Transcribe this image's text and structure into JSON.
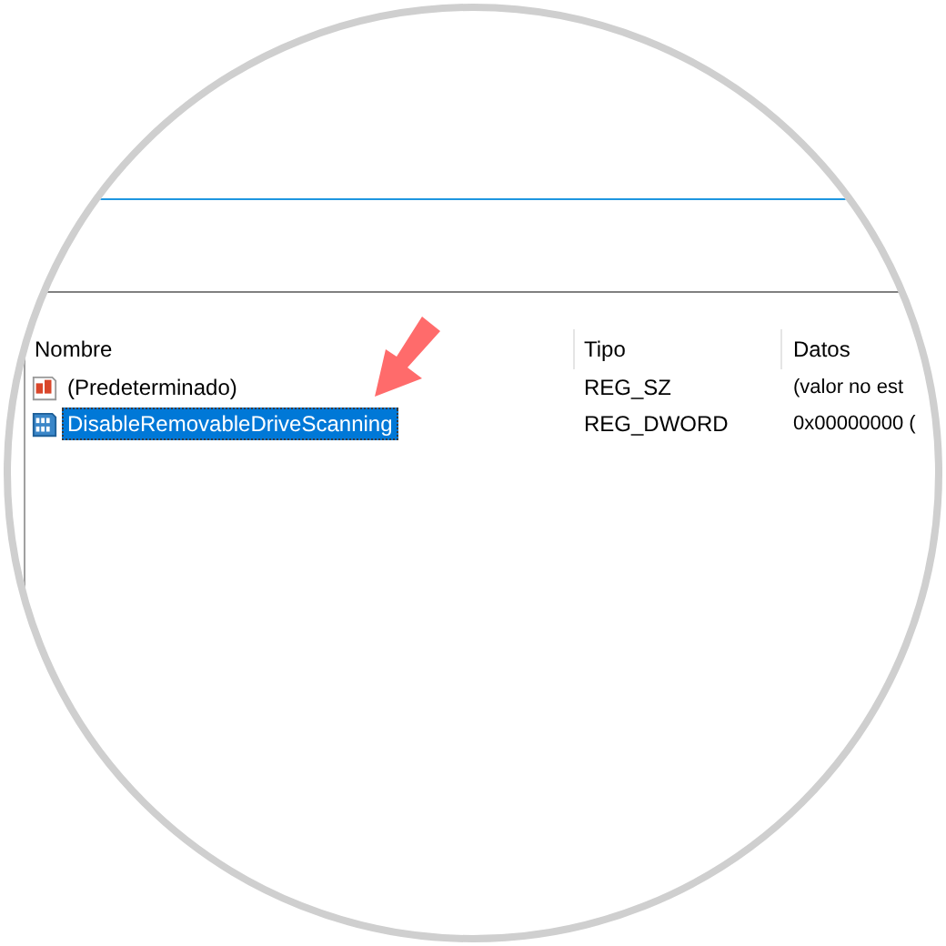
{
  "table": {
    "columns": [
      "Nombre",
      "Tipo",
      "Datos"
    ],
    "rows": [
      {
        "kind": "string",
        "name": "(Predeterminado)",
        "type": "REG_SZ",
        "data": "(valor no est",
        "selected": false
      },
      {
        "kind": "binary",
        "name": "DisableRemovableDriveScanning",
        "type": "REG_DWORD",
        "data": "0x00000000 (",
        "selected": true
      }
    ]
  }
}
